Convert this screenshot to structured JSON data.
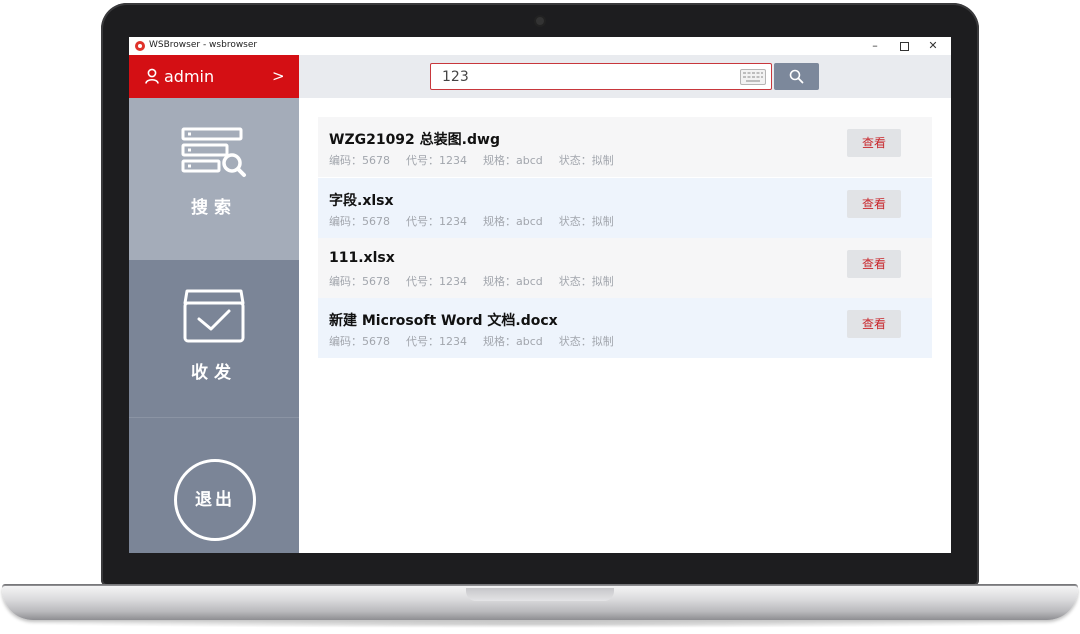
{
  "window": {
    "title": "WSBrowser - wsbrowser",
    "minimize_label": "–",
    "close_label": "✕"
  },
  "sidebar": {
    "user_name": "admin",
    "user_chevron": ">",
    "nav": [
      {
        "label": "搜索",
        "icon": "search-list-icon"
      },
      {
        "label": "收发",
        "icon": "inbox-check-icon"
      }
    ],
    "logout_label": "退出"
  },
  "search": {
    "value": "123",
    "keyboard_icon": "keyboard-icon",
    "button_icon": "search-icon"
  },
  "results": [
    {
      "name": "WZG21092 总装图.dwg",
      "code": "编码：5678",
      "number": "代号：1234",
      "spec": "规格：abcd",
      "status": "状态：拟制",
      "action": "查看"
    },
    {
      "name": "字段.xlsx",
      "code": "编码：5678",
      "number": "代号：1234",
      "spec": "规格：abcd",
      "status": "状态：拟制",
      "action": "查看"
    },
    {
      "name": "111.xlsx",
      "code": "编码：5678",
      "number": "代号：1234",
      "spec": "规格：abcd",
      "status": "状态：拟制",
      "action": "查看"
    },
    {
      "name": "新建 Microsoft Word 文档.docx",
      "code": "编码：5678",
      "number": "代号：1234",
      "spec": "规格：abcd",
      "status": "状态：拟制",
      "action": "查看"
    }
  ],
  "colors": {
    "brand_red": "#d40f14",
    "sidebar_gray": "#7b8597",
    "sidebar_active": "#a4acb9",
    "row_alt": "#eef4fc"
  }
}
